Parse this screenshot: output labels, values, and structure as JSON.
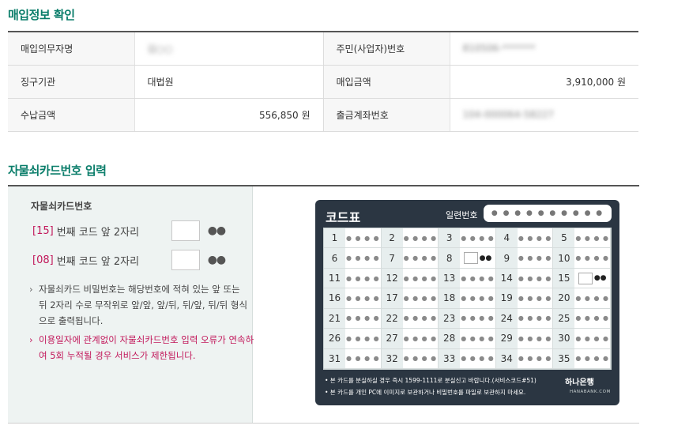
{
  "section1_title": "매입정보 확인",
  "section2_title": "자물쇠카드번호 입력",
  "info": {
    "r1": {
      "l1": "매입의무자명",
      "v1": "김○○",
      "l2": "주민(사업자)번호",
      "v2": "810506-*******"
    },
    "r2": {
      "l1": "징구기관",
      "v1": "대법원",
      "l2": "매입금액",
      "v2": "3,910,000 원"
    },
    "r3": {
      "l1": "수납금액",
      "v1": "556,850 원",
      "l2": "출금계좌번호",
      "v2": "104-000064-58227"
    }
  },
  "input": {
    "title": "자물쇠카드번호",
    "row1": {
      "num": "[15]",
      "text": "번째 코드 앞 2자리",
      "dots": "●●"
    },
    "row2": {
      "num": "[08]",
      "text": "번째 코드 앞 2자리",
      "dots": "●●"
    },
    "note1": "자물쇠카드 비밀번호는 해당번호에 적혀 있는 앞 또는 뒤 2자리 수로 무작위로 앞/앞, 앞/뒤, 뒤/앞, 뒤/뒤 형식으로 출력됩니다.",
    "note2": "이용일자에 관계없이 자물쇠카드번호 입력 오류가 연속하여 5회 누적될 경우 서비스가 제한됩니다."
  },
  "card": {
    "title": "코드표",
    "serial_label": "일련번호",
    "serial_value": "● ● ● ● ● ● ● ● ● ●",
    "cells": [
      "1",
      "2",
      "3",
      "4",
      "5",
      "6",
      "7",
      "8",
      "9",
      "10",
      "11",
      "12",
      "13",
      "14",
      "15",
      "16",
      "17",
      "18",
      "19",
      "20",
      "21",
      "22",
      "23",
      "24",
      "25",
      "26",
      "27",
      "28",
      "29",
      "30",
      "31",
      "32",
      "33",
      "34",
      "35"
    ],
    "masked": "● ● ● ●",
    "highlight_cells": [
      "8",
      "15"
    ],
    "highlight_dots": "●●",
    "footer1": "• 본 카드를 분실하실 경우 즉시 1599-1111로 분실신고 바랍니다.(서비스코드#51)",
    "footer2": "• 본 카드를 개인 PC에 이미지로 보관하거나 비밀번호를 파일로 보관하지 마세요.",
    "logo": "하나은행",
    "logo_sub": "HANABANK.COM"
  }
}
